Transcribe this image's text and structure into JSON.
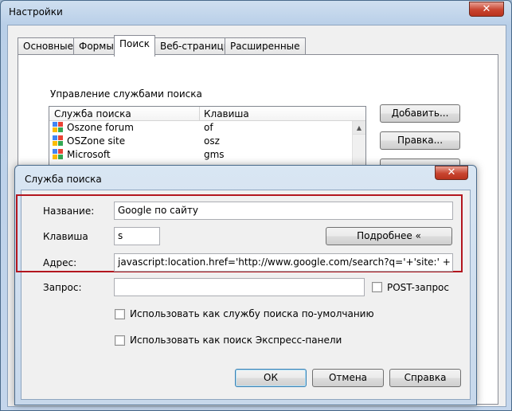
{
  "window": {
    "title": "Настройки",
    "close_glyph": "✕",
    "tabs": [
      {
        "label": "Основные"
      },
      {
        "label": "Формы"
      },
      {
        "label": "Поиск"
      },
      {
        "label": "Веб-страницы"
      },
      {
        "label": "Расширенные"
      }
    ],
    "active_tab": "Поиск",
    "section_label": "Управление службами поиска",
    "list": {
      "columns": [
        "Служба поиска",
        "Клавиша"
      ],
      "rows": [
        {
          "name": "Oszone forum",
          "key": "of",
          "icon": "google-icon"
        },
        {
          "name": "OSZone site",
          "key": "osz",
          "icon": "google-icon"
        },
        {
          "name": "Microsoft",
          "key": "gms",
          "icon": "google-icon"
        }
      ]
    },
    "buttons": {
      "add": "Добавить...",
      "edit": "Правка..."
    }
  },
  "dialog": {
    "title": "Служба поиска",
    "close_glyph": "✕",
    "name_label": "Название:",
    "name_value": "Google по сайту",
    "key_label": "Клавиша",
    "key_value": "s",
    "details_button": "Подробнее «",
    "address_label": "Адрес:",
    "address_value": "javascript:location.href='http://www.google.com/search?q='+'site:' + window.l",
    "query_label": "Запрос:",
    "query_value": "",
    "post_label": "POST-запрос",
    "default_label": "Использовать как службу поиска по-умолчанию",
    "express_label": "Использовать как поиск Экспресс-панели",
    "ok": "ОК",
    "cancel": "Отмена",
    "help": "Справка"
  },
  "colors": {
    "highlight_border": "#b3161e",
    "close_button": "#c8442f",
    "window_frame": "#b9cfe8"
  }
}
